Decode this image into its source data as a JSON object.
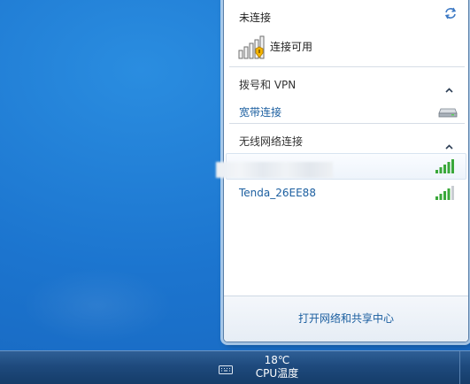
{
  "flyout": {
    "status_title": "未连接",
    "status_text": "连接可用",
    "dialup_section": "拨号和 VPN",
    "broadband_link": "宽带连接",
    "wireless_section": "无线网络连接",
    "networks": [
      {
        "name": "",
        "signal_bars": 5
      },
      {
        "name": "Tenda_26EE88",
        "signal_bars": 4
      }
    ],
    "footer_link": "打开网络和共享中心"
  },
  "taskbar": {
    "temperature": "18℃",
    "temperature_label": "CPU温度"
  },
  "colors": {
    "link": "#1c5fa0",
    "signal": "#3aa83a",
    "desktop": "#1c75cf"
  },
  "icons": [
    "refresh-icon",
    "signal-warning-icon",
    "modem-icon",
    "chevron-up-icon",
    "signal-bars-icon",
    "keyboard-icon"
  ]
}
